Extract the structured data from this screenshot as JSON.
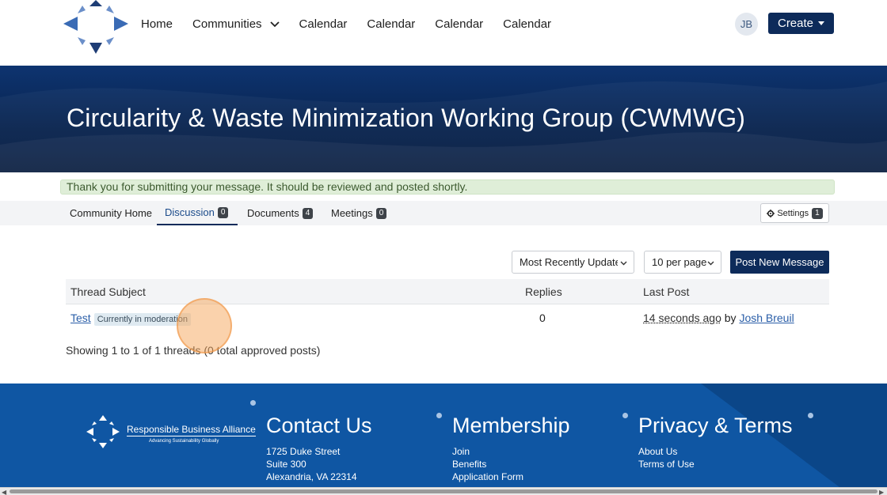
{
  "nav": {
    "items": [
      "Home",
      "Communities",
      "Calendar",
      "Calendar",
      "Calendar",
      "Calendar"
    ],
    "avatar_initials": "JB",
    "create_label": "Create"
  },
  "banner": {
    "title": "Circularity & Waste Minimization Working Group (CWMWG)"
  },
  "alert": {
    "message": "Thank you for submitting your message. It should be reviewed and posted shortly."
  },
  "tabs": [
    {
      "label": "Community Home",
      "count": null
    },
    {
      "label": "Discussion",
      "count": "0"
    },
    {
      "label": "Documents",
      "count": "4"
    },
    {
      "label": "Meetings",
      "count": "0"
    }
  ],
  "settings": {
    "label": "Settings",
    "count": "1"
  },
  "controls": {
    "sort_selected": "Most Recently Updated",
    "per_page_selected": "10 per page",
    "post_label": "Post New Message"
  },
  "table": {
    "headers": [
      "Thread Subject",
      "Replies",
      "Last Post"
    ],
    "rows": [
      {
        "subject": "Test",
        "status": "Currently in moderation",
        "replies": "0",
        "last_post_time": "14 seconds ago",
        "by": "by",
        "author": "Josh Breuil"
      }
    ]
  },
  "summary": "Showing 1 to 1 of 1 threads (0 total approved posts)",
  "footer": {
    "org_name": "Responsible Business Alliance",
    "org_tagline": "Advancing Sustainability Globally",
    "contact": {
      "title": "Contact Us",
      "lines": [
        "1725 Duke Street",
        "Suite 300",
        "Alexandria, VA 22314"
      ]
    },
    "membership": {
      "title": "Membership",
      "lines": [
        "Join",
        "Benefits",
        "Application Form"
      ]
    },
    "privacy": {
      "title": "Privacy & Terms",
      "lines": [
        "About Us",
        "Terms of Use"
      ]
    }
  },
  "colors": {
    "brand_navy": "#0d2b5a",
    "footer_blue": "#0f56a3",
    "alert_green": "#dfeed8",
    "link_blue": "#2a5ea8"
  }
}
